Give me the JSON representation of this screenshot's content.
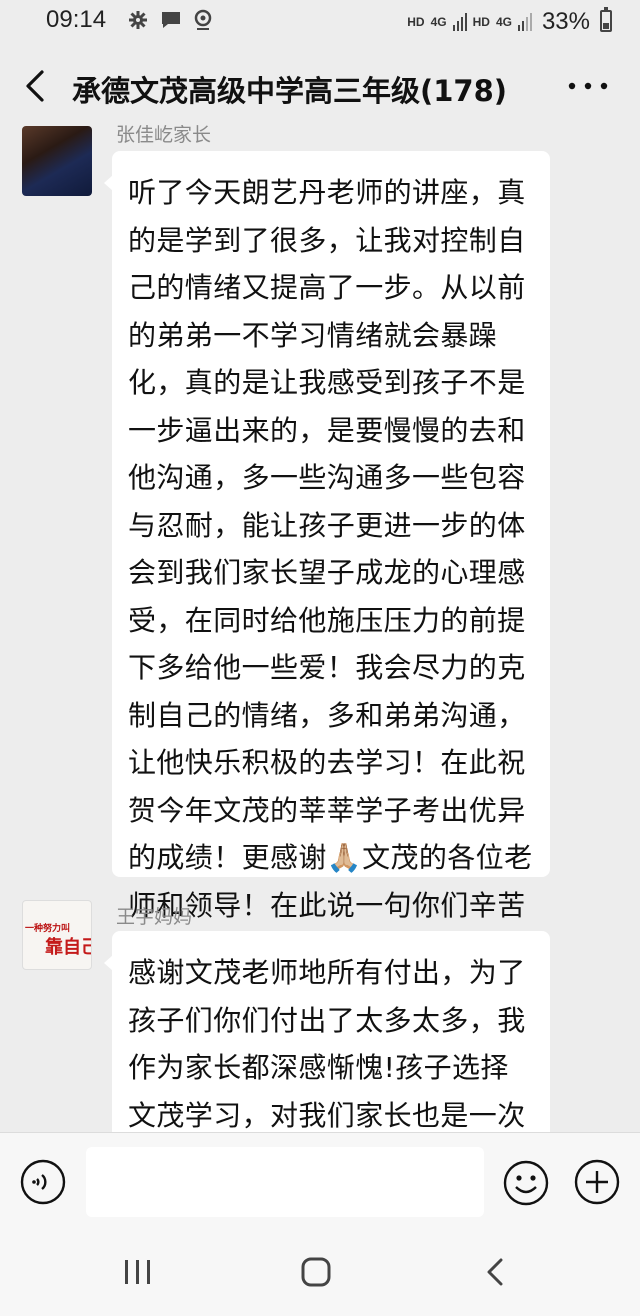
{
  "status_bar": {
    "time": "09:14",
    "net1": "HD",
    "net2": "4G",
    "net3": "HD",
    "net4": "4G",
    "battery_percent": "33%",
    "battery_level": 0.33,
    "icons": [
      "gear-icon",
      "chat-notification-icon",
      "location-icon",
      "signal-icon",
      "battery-icon"
    ]
  },
  "header": {
    "title": "承德文茂高级中学高三年级(178)",
    "back_icon": "chevron-left-icon",
    "more_icon": "more-dots-icon"
  },
  "messages": [
    {
      "sender": "张佳屹家长",
      "text_before_emoji": "听了今天朗艺丹老师的讲座，真的是学到了很多，让我对控制自己的情绪又提高了一步。从以前的弟弟一不学习情绪就会暴躁化，真的是让我感受到孩子不是一步逼出来的，是要慢慢的去和他沟通，多一些沟通多一些包容与忍耐，能让孩子更进一步的体会到我们家长望子成龙的心理感受，在同时给他施压压力的前提下多给他一些爱！我会尽力的克制自己的情绪，多和弟弟沟通，让他快乐积极的去学习！在此祝贺今年文茂的莘莘学子考出优异的成绩！更感谢",
      "emoji": "🙏🏼",
      "text_after_emoji": "文茂的各位老师和领导！在此说一句你们辛苦了！"
    },
    {
      "sender": "王宇妈妈",
      "avatar_text_small": "一种努力叫",
      "avatar_text_big": "靠自己",
      "text_before_emoji": "感谢文茂老师地所有付出，为了孩子们你们付出了太多太多，我作为家长都深感惭愧!孩子选择文茂学习，对我们家长也是一次人生的洗礼，我們的一笔用汗汗的",
      "emoji": "",
      "text_after_emoji": ""
    }
  ],
  "input_bar": {
    "placeholder": "",
    "icons": [
      "voice-icon",
      "emoji-icon",
      "plus-icon"
    ]
  },
  "nav_bar": {
    "icons": [
      "recent-apps-icon",
      "home-icon",
      "back-icon"
    ]
  }
}
